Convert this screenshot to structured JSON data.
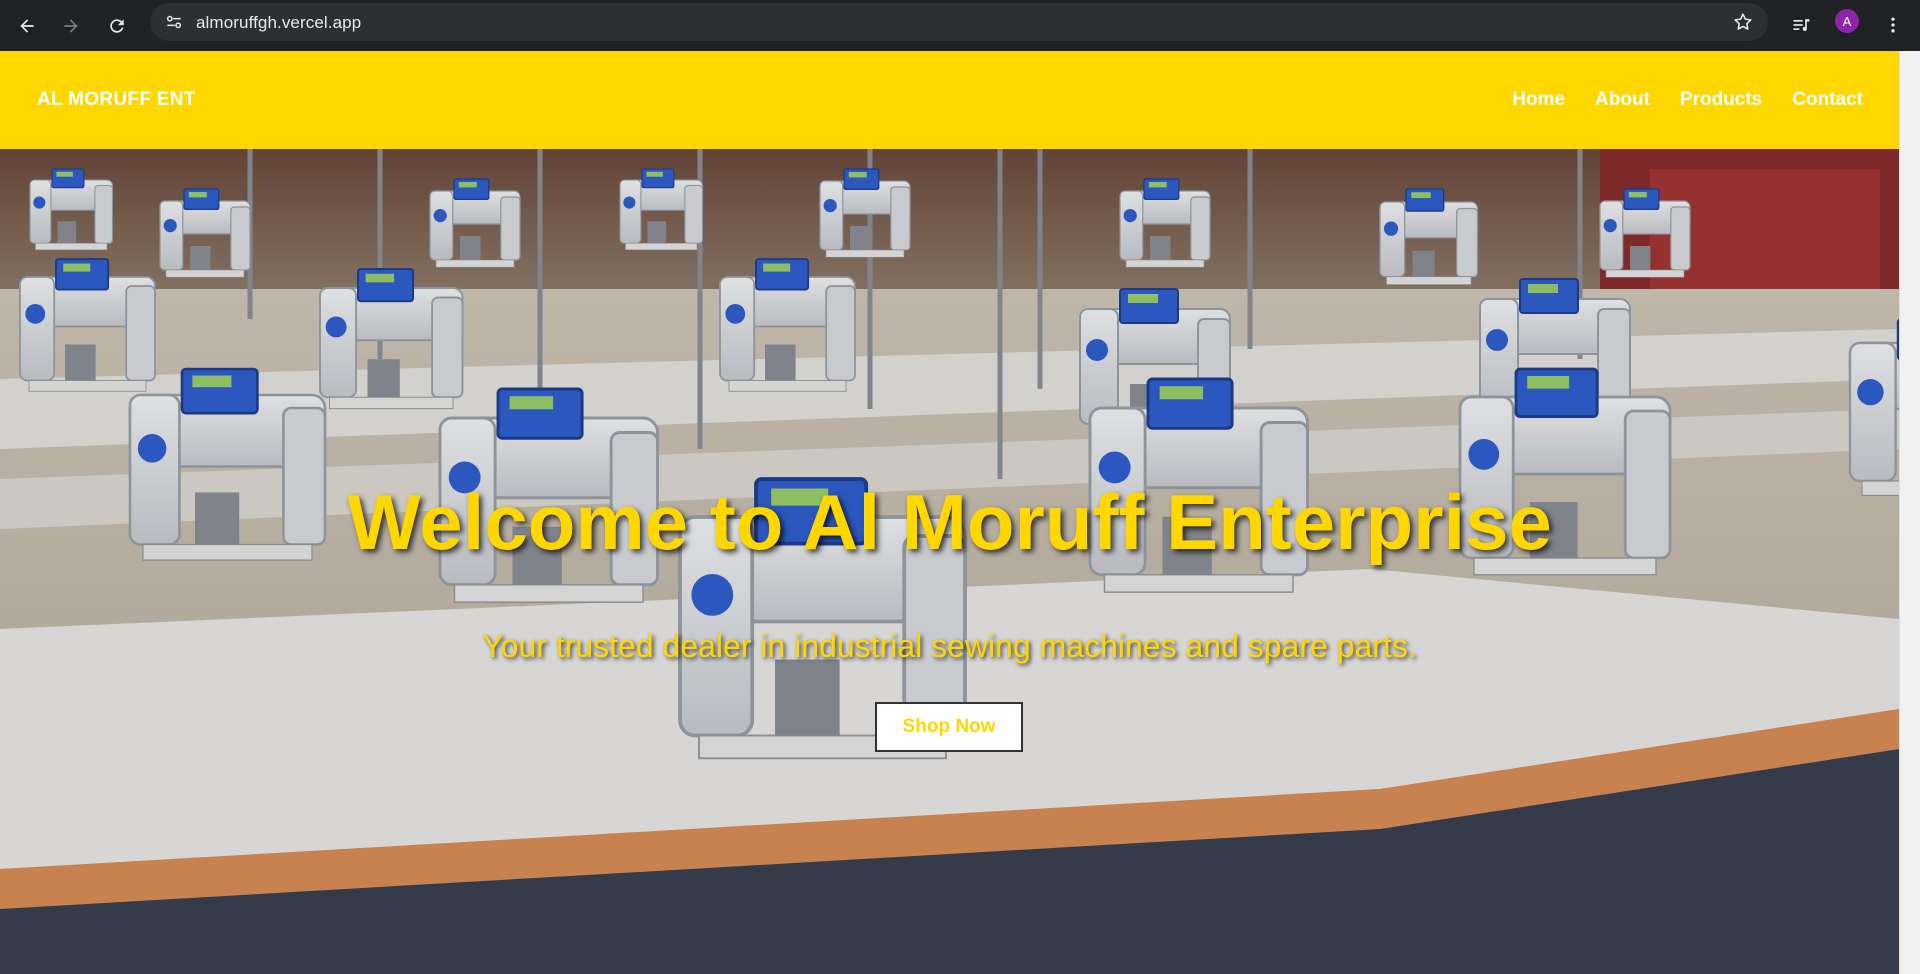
{
  "browser": {
    "url": "almoruffgh.vercel.app",
    "profile_initial": "A",
    "icons": [
      "back-icon",
      "forward-icon",
      "reload-icon",
      "site-info-icon",
      "star-icon",
      "media-queue-icon",
      "more-icon"
    ]
  },
  "site": {
    "brand": "AL MORUFF ENT",
    "nav": [
      "Home",
      "About",
      "Products",
      "Contact"
    ]
  },
  "hero": {
    "title": "Welcome to Al Moruff Enterprise",
    "subtitle": "Your trusted dealer in industrial sewing machines and spare parts.",
    "cta_label": "Shop Now"
  },
  "colors": {
    "brand_yellow": "#ffd700",
    "chrome_dark": "#202124",
    "omnibox": "#2e2f32",
    "avatar": "#8e24aa"
  }
}
